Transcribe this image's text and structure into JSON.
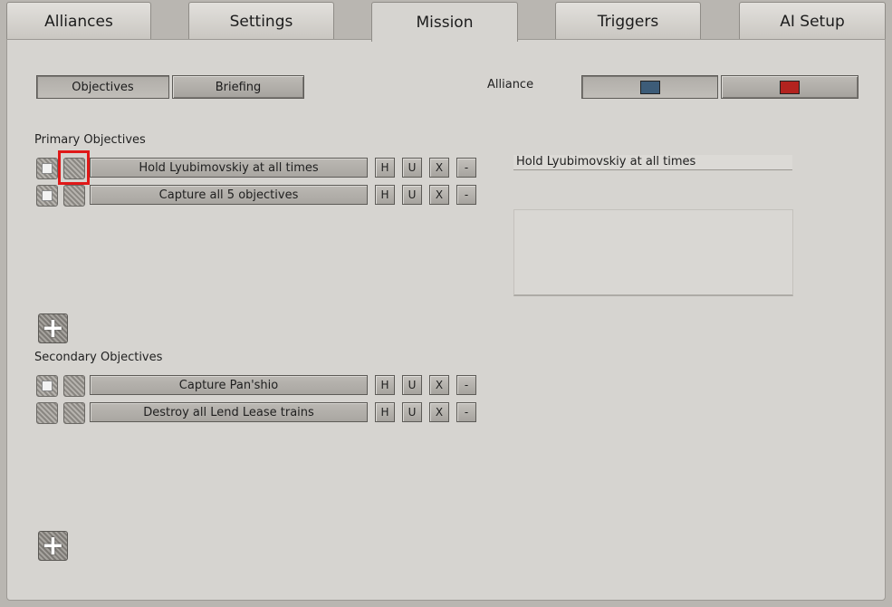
{
  "tabs": [
    "Alliances",
    "Settings",
    "Mission",
    "Triggers",
    "AI Setup"
  ],
  "subtabs": {
    "objectives": "Objectives",
    "briefing": "Briefing"
  },
  "alliance": {
    "label": "Alliance",
    "colors": [
      "#3d5c78",
      "#b3231f"
    ]
  },
  "primary": {
    "heading": "Primary Objectives",
    "items": [
      {
        "name": "Hold Lyubimovskiy at all times"
      },
      {
        "name": "Capture all 5 objectives"
      }
    ]
  },
  "secondary": {
    "heading": "Secondary Objectives",
    "items": [
      {
        "name": "Capture Pan'shio"
      },
      {
        "name": "Destroy all Lend Lease trains"
      }
    ]
  },
  "row_buttons": {
    "h": "H",
    "u": "U",
    "x": "X",
    "remove": "-"
  },
  "add_symbol": "+",
  "selected_objective": {
    "name": "Hold Lyubimovskiy at all times",
    "description": ""
  }
}
